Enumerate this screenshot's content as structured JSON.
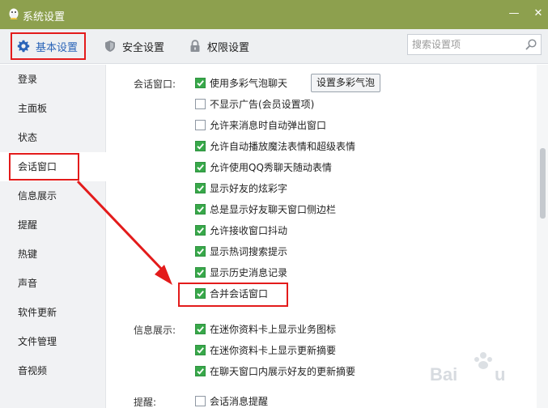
{
  "window": {
    "title": "系统设置",
    "minimize_symbol": "—",
    "close_symbol": "✕"
  },
  "toolbar": {
    "tabs": [
      {
        "label": "基本设置",
        "icon": "gear-icon",
        "active": true
      },
      {
        "label": "安全设置",
        "icon": "shield-icon",
        "active": false
      },
      {
        "label": "权限设置",
        "icon": "lock-icon",
        "active": false
      }
    ],
    "search_placeholder": "搜索设置项"
  },
  "sidebar": {
    "items": [
      {
        "label": "登录"
      },
      {
        "label": "主面板"
      },
      {
        "label": "状态"
      },
      {
        "label": "会话窗口",
        "active": true
      },
      {
        "label": "信息展示"
      },
      {
        "label": "提醒"
      },
      {
        "label": "热键"
      },
      {
        "label": "声音"
      },
      {
        "label": "软件更新"
      },
      {
        "label": "文件管理"
      },
      {
        "label": "音视频"
      }
    ]
  },
  "sections": {
    "chat_window": {
      "label": "会话窗口:",
      "button_label": "设置多彩气泡",
      "options": [
        {
          "label": "使用多彩气泡聊天",
          "checked": true
        },
        {
          "label": "不显示广告(会员设置项)",
          "checked": false
        },
        {
          "label": "允许来消息时自动弹出窗口",
          "checked": false
        },
        {
          "label": "允许自动播放魔法表情和超级表情",
          "checked": true
        },
        {
          "label": "允许使用QQ秀聊天随动表情",
          "checked": true
        },
        {
          "label": "显示好友的炫彩字",
          "checked": true
        },
        {
          "label": "总是显示好友聊天窗口侧边栏",
          "checked": true
        },
        {
          "label": "允许接收窗口抖动",
          "checked": true
        },
        {
          "label": "显示热词搜索提示",
          "checked": true
        },
        {
          "label": "显示历史消息记录",
          "checked": true
        },
        {
          "label": "合并会话窗口",
          "checked": true
        }
      ]
    },
    "info_display": {
      "label": "信息展示:",
      "options": [
        {
          "label": "在迷你资料卡上显示业务图标",
          "checked": true
        },
        {
          "label": "在迷你资料卡上显示更新摘要",
          "checked": true
        },
        {
          "label": "在聊天窗口内展示好友的更新摘要",
          "checked": true
        }
      ]
    },
    "reminder": {
      "label": "提醒:",
      "options": [
        {
          "label": "会话消息提醒",
          "checked": false
        }
      ]
    }
  },
  "colors": {
    "titlebar": "#8da04e",
    "accent": "#2a64b8",
    "checkbox_on": "#38a84a",
    "annotation_red": "#e31b1b"
  }
}
